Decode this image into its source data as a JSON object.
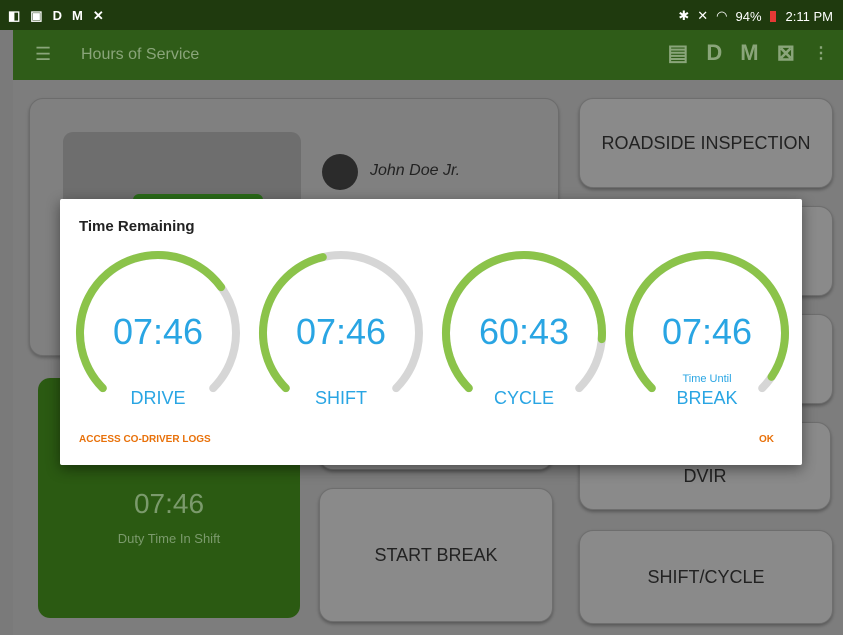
{
  "status_bar": {
    "left_icons": [
      "D",
      "M"
    ],
    "battery": "94%",
    "time": "2:11 PM"
  },
  "app_bar": {
    "title": "Hours of Service",
    "actions": [
      "D",
      "M"
    ]
  },
  "background": {
    "driver_name": "John Doe Jr.",
    "buttons": {
      "roadside_inspection": "ROADSIDE INSPECTION",
      "dvir": "DVIR",
      "start_break": "START BREAK",
      "shift_cycle": "SHIFT/CYCLE"
    },
    "duty_time": "07:46",
    "duty_time_label": "Duty Time In Shift"
  },
  "dialog": {
    "title": "Time Remaining",
    "gauges": [
      {
        "value": "07:46",
        "label": "DRIVE",
        "sublabel": "",
        "progress": 0.7
      },
      {
        "value": "07:46",
        "label": "SHIFT",
        "sublabel": "",
        "progress": 0.45
      },
      {
        "value": "60:43",
        "label": "CYCLE",
        "sublabel": "",
        "progress": 0.85
      },
      {
        "value": "07:46",
        "label": "BREAK",
        "sublabel": "Time Until",
        "progress": 0.96
      }
    ],
    "left_action": "ACCESS CO-DRIVER LOGS",
    "right_action": "OK"
  },
  "colors": {
    "arc_progress": "#8bc34a",
    "arc_track": "#d6d6d6",
    "value_text": "#29a5e3",
    "action_text": "#e8710a"
  }
}
